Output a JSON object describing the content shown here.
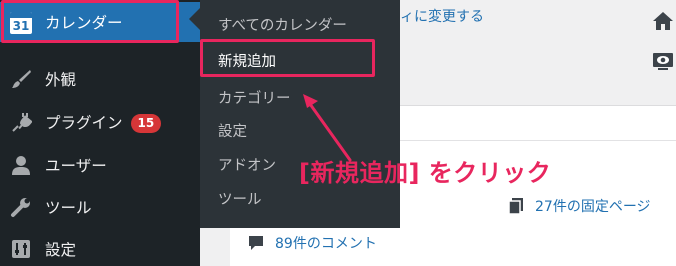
{
  "sidebar": {
    "items": [
      {
        "label": "カレンダー",
        "icon": "calendar-icon",
        "icon_text": "31",
        "current": true
      },
      {
        "label": "外観",
        "icon": "paintbrush-icon"
      },
      {
        "label": "プラグイン",
        "icon": "plugin-icon",
        "badge": "15"
      },
      {
        "label": "ユーザー",
        "icon": "user-icon"
      },
      {
        "label": "ツール",
        "icon": "wrench-icon"
      },
      {
        "label": "設定",
        "icon": "settings-icon"
      }
    ]
  },
  "submenu": {
    "items": [
      {
        "label": "すべてのカレンダー"
      },
      {
        "label": "新規追加",
        "highlighted": true
      },
      {
        "label": "カテゴリー"
      },
      {
        "label": "設定"
      },
      {
        "label": "アドオン"
      },
      {
        "label": "ツール"
      }
    ]
  },
  "content": {
    "top_link": "ィに変更する",
    "pages_link": "27件の固定ページ",
    "comments_link": "89件のコメント"
  },
  "annotation": {
    "text": "[新規追加] をクリック",
    "color": "#e8265e"
  },
  "colors": {
    "sidebar_bg": "#1d2327",
    "submenu_bg": "#2c3338",
    "current_bg": "#2271b1",
    "link": "#2271b1",
    "badge": "#d63638",
    "highlight": "#e8265e"
  }
}
